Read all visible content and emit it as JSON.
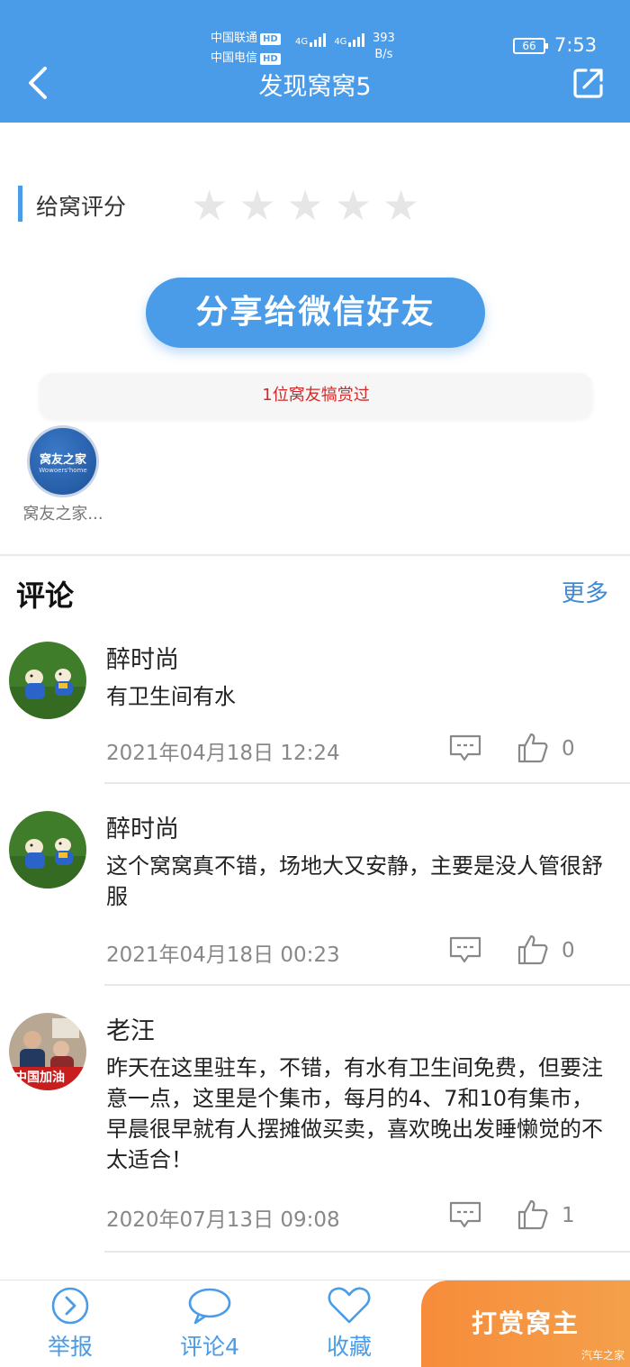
{
  "status_bar": {
    "carrier1": "中国联通",
    "carrier2": "中国电信",
    "hd": "HD",
    "net": "4G",
    "speed_value": "393",
    "speed_unit": "B/s",
    "battery": "66",
    "time": "7:53"
  },
  "header": {
    "title": "发现窝窝5"
  },
  "rating": {
    "label": "给窝评分",
    "stars": 5,
    "filled": 0
  },
  "share": {
    "button_label": "分享给微信好友"
  },
  "tips": {
    "summary": "1位窝友犒赏过",
    "tipper_logo_cn": "窝友之家",
    "tipper_logo_en": "Wowoers'home",
    "tipper_name": "窝友之家..."
  },
  "comments": {
    "title": "评论",
    "more": "更多",
    "items": [
      {
        "name": "醉时尚",
        "text": "有卫生间有水",
        "time": "2021年04月18日 12:24",
        "likes": "0"
      },
      {
        "name": "醉时尚",
        "text": "这个窝窝真不错，场地大又安静，主要是没人管很舒服",
        "time": "2021年04月18日 00:23",
        "likes": "0"
      },
      {
        "name": "老汪",
        "text": "昨天在这里驻车，不错，有水有卫生间免费，但要注意一点，这里是个集市，每月的4、7和10有集市，早晨很早就有人摆摊做买卖，喜欢晚出发睡懒觉的不太适合！",
        "time": "2020年07月13日 09:08",
        "likes": "1"
      }
    ],
    "avatar3_caption": "中国加油"
  },
  "bottom_bar": {
    "report": "举报",
    "comment": "评论4",
    "favorite": "收藏",
    "reward": "打赏窝主"
  },
  "watermark": "汽车之家",
  "colors": {
    "primary": "#4a9be8",
    "accent": "#f78c3a",
    "tip_text": "#d22a2a"
  }
}
